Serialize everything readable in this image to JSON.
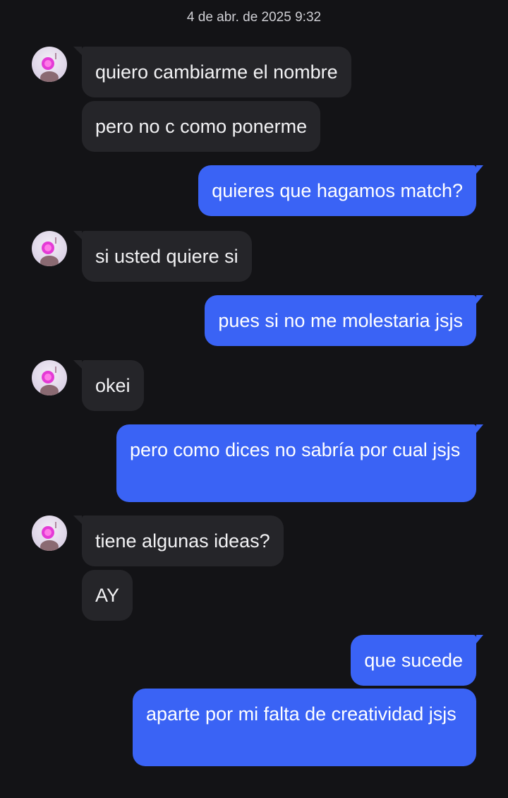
{
  "chat": {
    "timestamp": "4 de abr. de 2025 9:32",
    "messages": [
      {
        "from": "them",
        "text": "quiero cambiarme el nombre"
      },
      {
        "from": "them",
        "text": "pero no c como ponerme"
      },
      {
        "from": "me",
        "text": "quieres que hagamos match?"
      },
      {
        "from": "them",
        "text": "si usted quiere si"
      },
      {
        "from": "me",
        "text": "pues si no me molestaria jsjs"
      },
      {
        "from": "them",
        "text": "okei"
      },
      {
        "from": "me",
        "text": "pero como dices no sabría por cual jsjs"
      },
      {
        "from": "them",
        "text": "tiene algunas ideas?"
      },
      {
        "from": "them",
        "text": "AY"
      },
      {
        "from": "me",
        "text": "que sucede"
      },
      {
        "from": "me",
        "text": "aparte por mi falta de creatividad jsjs"
      }
    ]
  },
  "colors": {
    "background": "#131316",
    "incoming_bubble": "#252529",
    "outgoing_bubble": "#3a63f5"
  },
  "icons": {
    "avatar": "contact-avatar-photo"
  }
}
